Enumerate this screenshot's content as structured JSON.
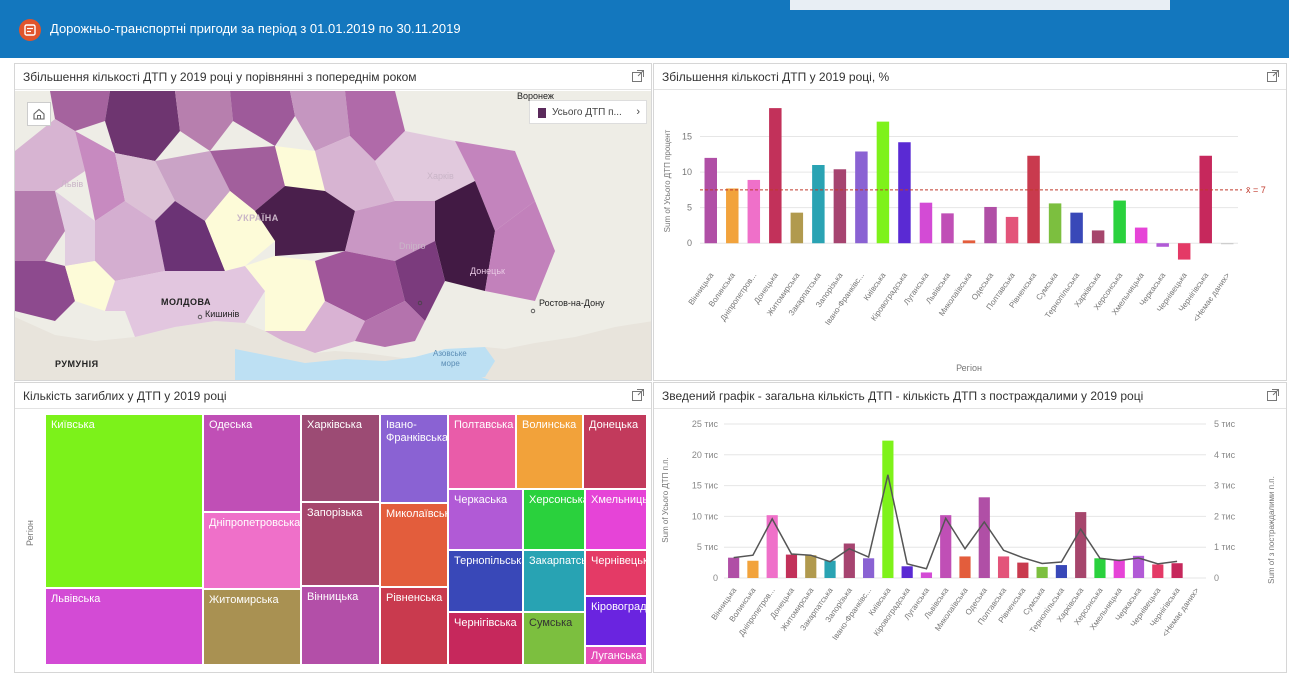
{
  "header": {
    "title": "Дорожньо-транспортні пригоди за період з 01.01.2019 по 30.11.2019",
    "icon": "dashboard-icon",
    "bar_color": "#1377be"
  },
  "panels": {
    "map": {
      "title": "Збільшення кількості ДТП у 2019 році у порівнянні з попереднім роком",
      "legend_label": "Усього ДТП п...",
      "labels": {
        "voronezh": "Воронеж",
        "lviv": "Львів",
        "kharkiv": "Харків",
        "ukraina": "УКРАЇНА",
        "dnipro": "Dnipro",
        "donetsk": "Донецьк",
        "moldova": "МОЛДОВА",
        "chisinau": "Кишинів",
        "rostov": "Ростов-на-Дону",
        "romania": "РУМУНІЯ",
        "azov": "Азовське",
        "azov2": "море"
      }
    },
    "bar_percent": {
      "title": "Збільшення кількості ДТП у 2019 році, %"
    },
    "treemap": {
      "title": "Кількість загиблих у ДТП у 2019 році",
      "axis_label": "Регіон",
      "cells": [
        {
          "label": "Київська",
          "color": "#7cf21a"
        },
        {
          "label": "Львівська",
          "color": "#d34bd5"
        },
        {
          "label": "Одеська",
          "color": "#c04fb6"
        },
        {
          "label": "Дніпропетровська",
          "color": "#ef70c9"
        },
        {
          "label": "Житомирська",
          "color": "#a99152"
        },
        {
          "label": "Харківська",
          "color": "#9c4b74"
        },
        {
          "label": "Запорізька",
          "color": "#a6466c"
        },
        {
          "label": "Вінницька",
          "color": "#b34fa8"
        },
        {
          "label": "Івано-Франківська",
          "color": "#8a62d3"
        },
        {
          "label": "Миколаївська",
          "color": "#e35d3c"
        },
        {
          "label": "Рівненська",
          "color": "#c93a4e"
        },
        {
          "label": "Полтавська",
          "color": "#e95ca9"
        },
        {
          "label": "Волинська",
          "color": "#f2a23a"
        },
        {
          "label": "Донецька",
          "color": "#c23a5c"
        },
        {
          "label": "Черкаська",
          "color": "#b15ad6"
        },
        {
          "label": "Херсонська",
          "color": "#2ad13d"
        },
        {
          "label": "Хмельницька",
          "color": "#e644d7"
        },
        {
          "label": "Тернопільська",
          "color": "#3948b8"
        },
        {
          "label": "Закарпатська",
          "color": "#28a3b3"
        },
        {
          "label": "Чернівецька",
          "color": "#e43a66"
        },
        {
          "label": "Чернігівська",
          "color": "#c6285c"
        },
        {
          "label": "Сумська",
          "color": "#7cbf3f"
        },
        {
          "label": "Кіровоградська",
          "color": "#6a24e0"
        },
        {
          "label": "Луганська",
          "color": "#e64fb9"
        }
      ]
    },
    "combo": {
      "title": "Зведений графік - загальна кількість ДТП - кількість ДТП з постраждалими у 2019 році"
    }
  },
  "chart_data": [
    {
      "type": "bar",
      "title": "Збільшення кількості ДТП у 2019 році, %",
      "xlabel": "Регіон",
      "ylabel": "Sum of Усього ДТП процент",
      "ylim": [
        -2.5,
        20
      ],
      "yticks": [
        0,
        5,
        10,
        15
      ],
      "grid": true,
      "reference_line": {
        "label": "x̄ = 7",
        "value": 7.5,
        "color": "#c0392b"
      },
      "categories": [
        "Вінницька",
        "Волинська",
        "Дніпропетров...",
        "Донецька",
        "Житомирська",
        "Закарпатська",
        "Запорізька",
        "Івано-Франківс...",
        "Київська",
        "Кіровоградська",
        "Луганська",
        "Львівська",
        "Миколаївська",
        "Одеська",
        "Полтавська",
        "Рівненська",
        "Сумська",
        "Тернопільська",
        "Харківська",
        "Херсонська",
        "Хмельницька",
        "Черкаська",
        "Чернівецька",
        "Чернігівська",
        "<Немає даних>"
      ],
      "values": [
        12,
        7.7,
        8.9,
        19,
        4.3,
        11,
        10.4,
        12.9,
        17.1,
        14.2,
        5.7,
        4.2,
        0.4,
        5.1,
        3.7,
        12.3,
        5.6,
        4.3,
        1.8,
        6,
        2.2,
        -0.5,
        -2.3,
        12.3,
        0
      ],
      "colors": [
        "#b04fa6",
        "#f2a33c",
        "#ef70c9",
        "#c2315a",
        "#b19a4e",
        "#2aa3b3",
        "#a64470",
        "#8a62d3",
        "#7ef21a",
        "#5a2ad3",
        "#d34bd5",
        "#c04fb6",
        "#e35d3c",
        "#b04fa6",
        "#e3547a",
        "#c93a4e",
        "#7cbf3f",
        "#3948b8",
        "#a6466c",
        "#2ad13d",
        "#e644d7",
        "#b15ad6",
        "#e43a66",
        "#c6285c",
        "#c8c8c8"
      ]
    },
    {
      "type": "bar",
      "title": "Зведений графік - загальна кількість ДТП - кількість ДТП з постраждалими у 2019 році",
      "ylabel": "Sum of Усього ДТП п.п.",
      "y2label": "Sum of з постраждалими п.п.",
      "ylim": [
        0,
        25000
      ],
      "y2lim": [
        0,
        5000
      ],
      "yticks": [
        "0",
        "5 тис",
        "10 тис",
        "15 тис",
        "20 тис",
        "25 тис"
      ],
      "y2ticks": [
        "0",
        "1 тис",
        "2 тис",
        "3 тис",
        "4 тис",
        "5 тис"
      ],
      "grid": true,
      "categories": [
        "Вінницька",
        "Волинська",
        "Дніпропетров...",
        "Донецька",
        "Житомирська",
        "Закарпатська",
        "Запорізька",
        "Івано-Франківс...",
        "Київська",
        "Кіровоградська",
        "Луганська",
        "Львівська",
        "Миколаївська",
        "Одеська",
        "Полтавська",
        "Рівненська",
        "Сумська",
        "Тернопільська",
        "Харківська",
        "Херсонська",
        "Хмельницька",
        "Черкаська",
        "Чернівецька",
        "Чернігівська",
        "<Немає даних>"
      ],
      "series": [
        {
          "type": "bar",
          "values": [
            3300,
            2800,
            10200,
            3800,
            3700,
            2800,
            5600,
            3200,
            22300,
            1900,
            900,
            10200,
            3500,
            13100,
            3500,
            2500,
            1800,
            2100,
            10700,
            3200,
            3000,
            3600,
            2200,
            2400,
            0
          ]
        },
        {
          "type": "line",
          "color": "#555555",
          "values": [
            660,
            740,
            1920,
            780,
            740,
            530,
            950,
            680,
            3350,
            460,
            300,
            1940,
            950,
            1820,
            900,
            660,
            470,
            520,
            1590,
            640,
            570,
            650,
            460,
            540,
            0
          ]
        }
      ],
      "colors": [
        "#b04fa6",
        "#f2a33c",
        "#ef70c9",
        "#c2315a",
        "#b19a4e",
        "#2aa3b3",
        "#a64470",
        "#8a62d3",
        "#7ef21a",
        "#5a2ad3",
        "#d34bd5",
        "#c04fb6",
        "#e35d3c",
        "#b04fa6",
        "#e3547a",
        "#c93a4e",
        "#7cbf3f",
        "#3948b8",
        "#a6466c",
        "#2ad13d",
        "#e644d7",
        "#b15ad6",
        "#e43a66",
        "#c6285c",
        "#c8c8c8"
      ]
    }
  ]
}
